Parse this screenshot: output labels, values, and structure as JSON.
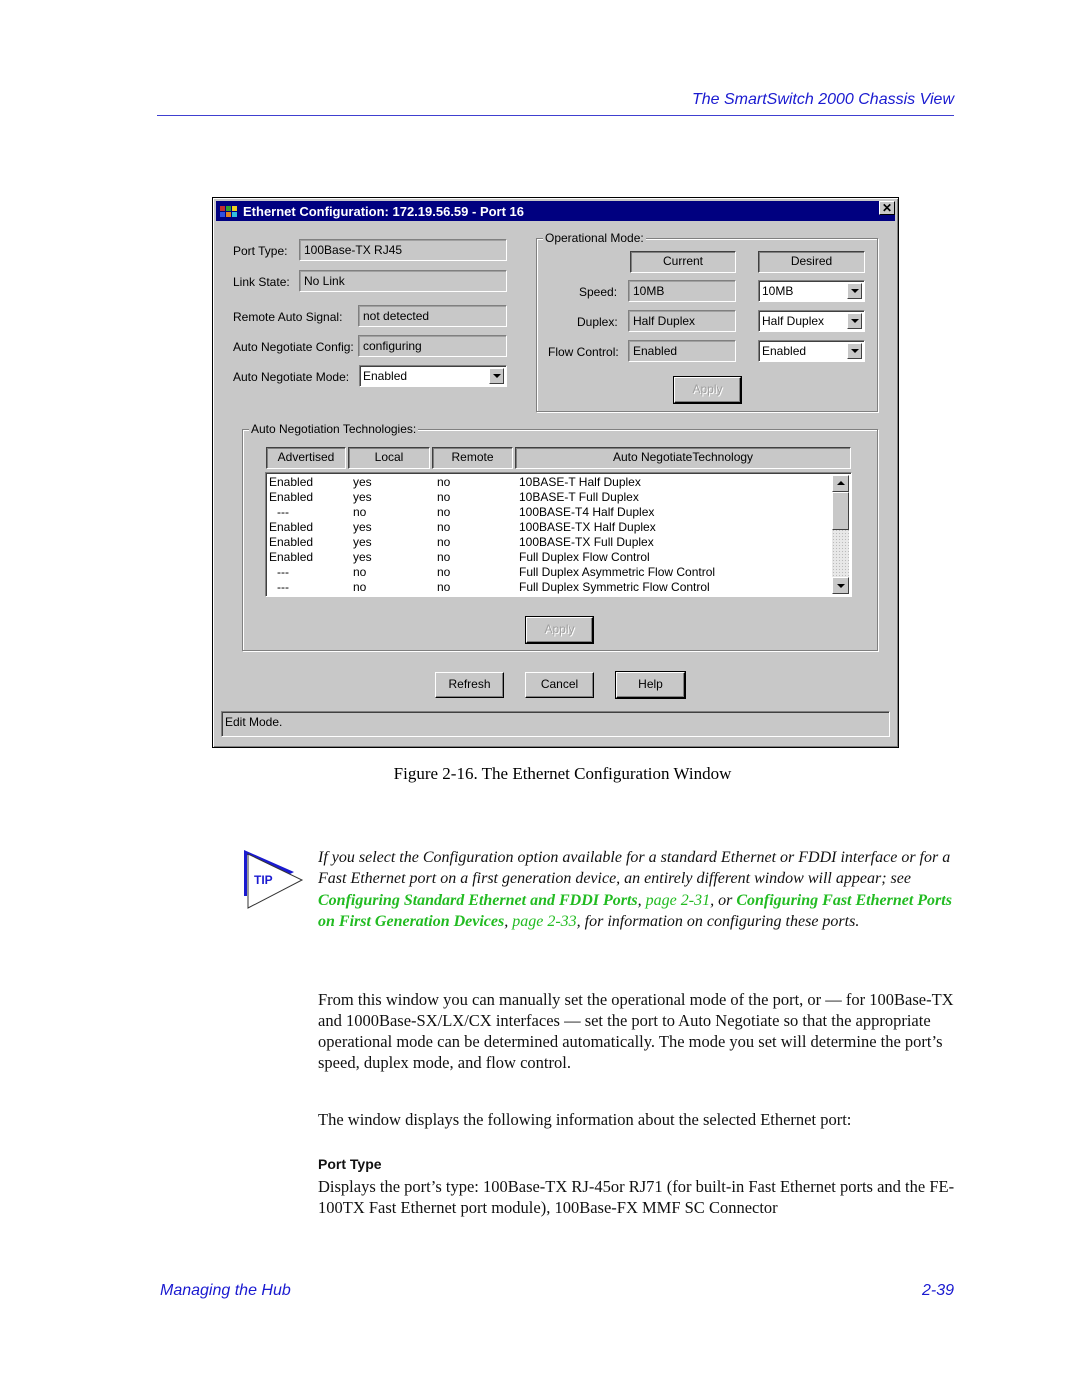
{
  "page": {
    "running_head": "The SmartSwitch 2000 Chassis View",
    "footer_left": "Managing the Hub",
    "footer_right": "2-39"
  },
  "window": {
    "title": "Ethernet Configuration: 172.19.56.59 - Port 16",
    "close_glyph": "✕",
    "left_fields": [
      {
        "label": "Port Type:",
        "value": "100Base-TX RJ45"
      },
      {
        "label": "Link State:",
        "value": "No Link"
      },
      {
        "label": "Remote Auto Signal:",
        "value": "not detected"
      },
      {
        "label": "Auto Negotiate Config:",
        "value": "configuring"
      }
    ],
    "auto_negotiate_mode": {
      "label": "Auto Negotiate Mode:",
      "value": "Enabled"
    },
    "operational_mode": {
      "title": "Operational Mode:",
      "col_current": "Current",
      "col_desired": "Desired",
      "rows": [
        {
          "label": "Speed:",
          "current": "10MB",
          "desired": "10MB"
        },
        {
          "label": "Duplex:",
          "current": "Half Duplex",
          "desired": "Half Duplex"
        },
        {
          "label": "Flow Control:",
          "current": "Enabled",
          "desired": "Enabled"
        }
      ],
      "apply_label": "Apply"
    },
    "auto_neg_tech": {
      "title": "Auto Negotiation Technologies:",
      "columns": [
        "Advertised",
        "Local",
        "Remote",
        "Auto NegotiateTechnology"
      ],
      "rows": [
        [
          "Enabled",
          "yes",
          "no",
          "10BASE-T Half Duplex"
        ],
        [
          "Enabled",
          "yes",
          "no",
          "10BASE-T Full Duplex"
        ],
        [
          "  ---",
          "no",
          "no",
          "100BASE-T4 Half Duplex"
        ],
        [
          "Enabled",
          "yes",
          "no",
          "100BASE-TX Half Duplex"
        ],
        [
          "Enabled",
          "yes",
          "no",
          "100BASE-TX Full Duplex"
        ],
        [
          "Enabled",
          "yes",
          "no",
          "Full Duplex Flow Control"
        ],
        [
          "  ---",
          "no",
          "no",
          "Full Duplex Asymmetric Flow Control"
        ],
        [
          "  ---",
          "no",
          "no",
          "Full Duplex Symmetric Flow Control"
        ]
      ],
      "apply_label": "Apply"
    },
    "buttons": {
      "refresh": "Refresh",
      "cancel": "Cancel",
      "help": "Help"
    },
    "status": "Edit Mode."
  },
  "caption": "Figure 2-16.  The Ethernet Configuration Window",
  "tip": {
    "label": "TIP",
    "text_1": "If you select the Configuration option available for a standard Ethernet or FDDI interface or for a Fast Ethernet port on a first generation device, an entirely different window will appear; see ",
    "link_1": "Configuring Standard Ethernet and FDDI Ports",
    "sep_1": ", ",
    "page_1": "page 2-31",
    "text_2": ", or ",
    "link_2": "Configuring Fast Ethernet Ports on First Generation Devices",
    "sep_2": ", ",
    "page_2": "page 2-33",
    "text_3": ", for information on configuring these ports."
  },
  "body": {
    "para_1": "From this window you can manually set the operational mode of the port, or — for 100Base-TX and 1000Base-SX/LX/CX interfaces — set the port to Auto Negotiate so that the appropriate operational mode can be determined automatically. The mode you set will determine the port’s speed, duplex mode, and flow control.",
    "para_2": "The window displays the following information about the selected Ethernet port:",
    "subhead": "Port Type",
    "para_3": "Displays the port’s type: 100Base-TX RJ-45or RJ71 (for built-in Fast Ethernet ports and the FE-100TX Fast Ethernet port module), 100Base-FX MMF SC Connector"
  }
}
